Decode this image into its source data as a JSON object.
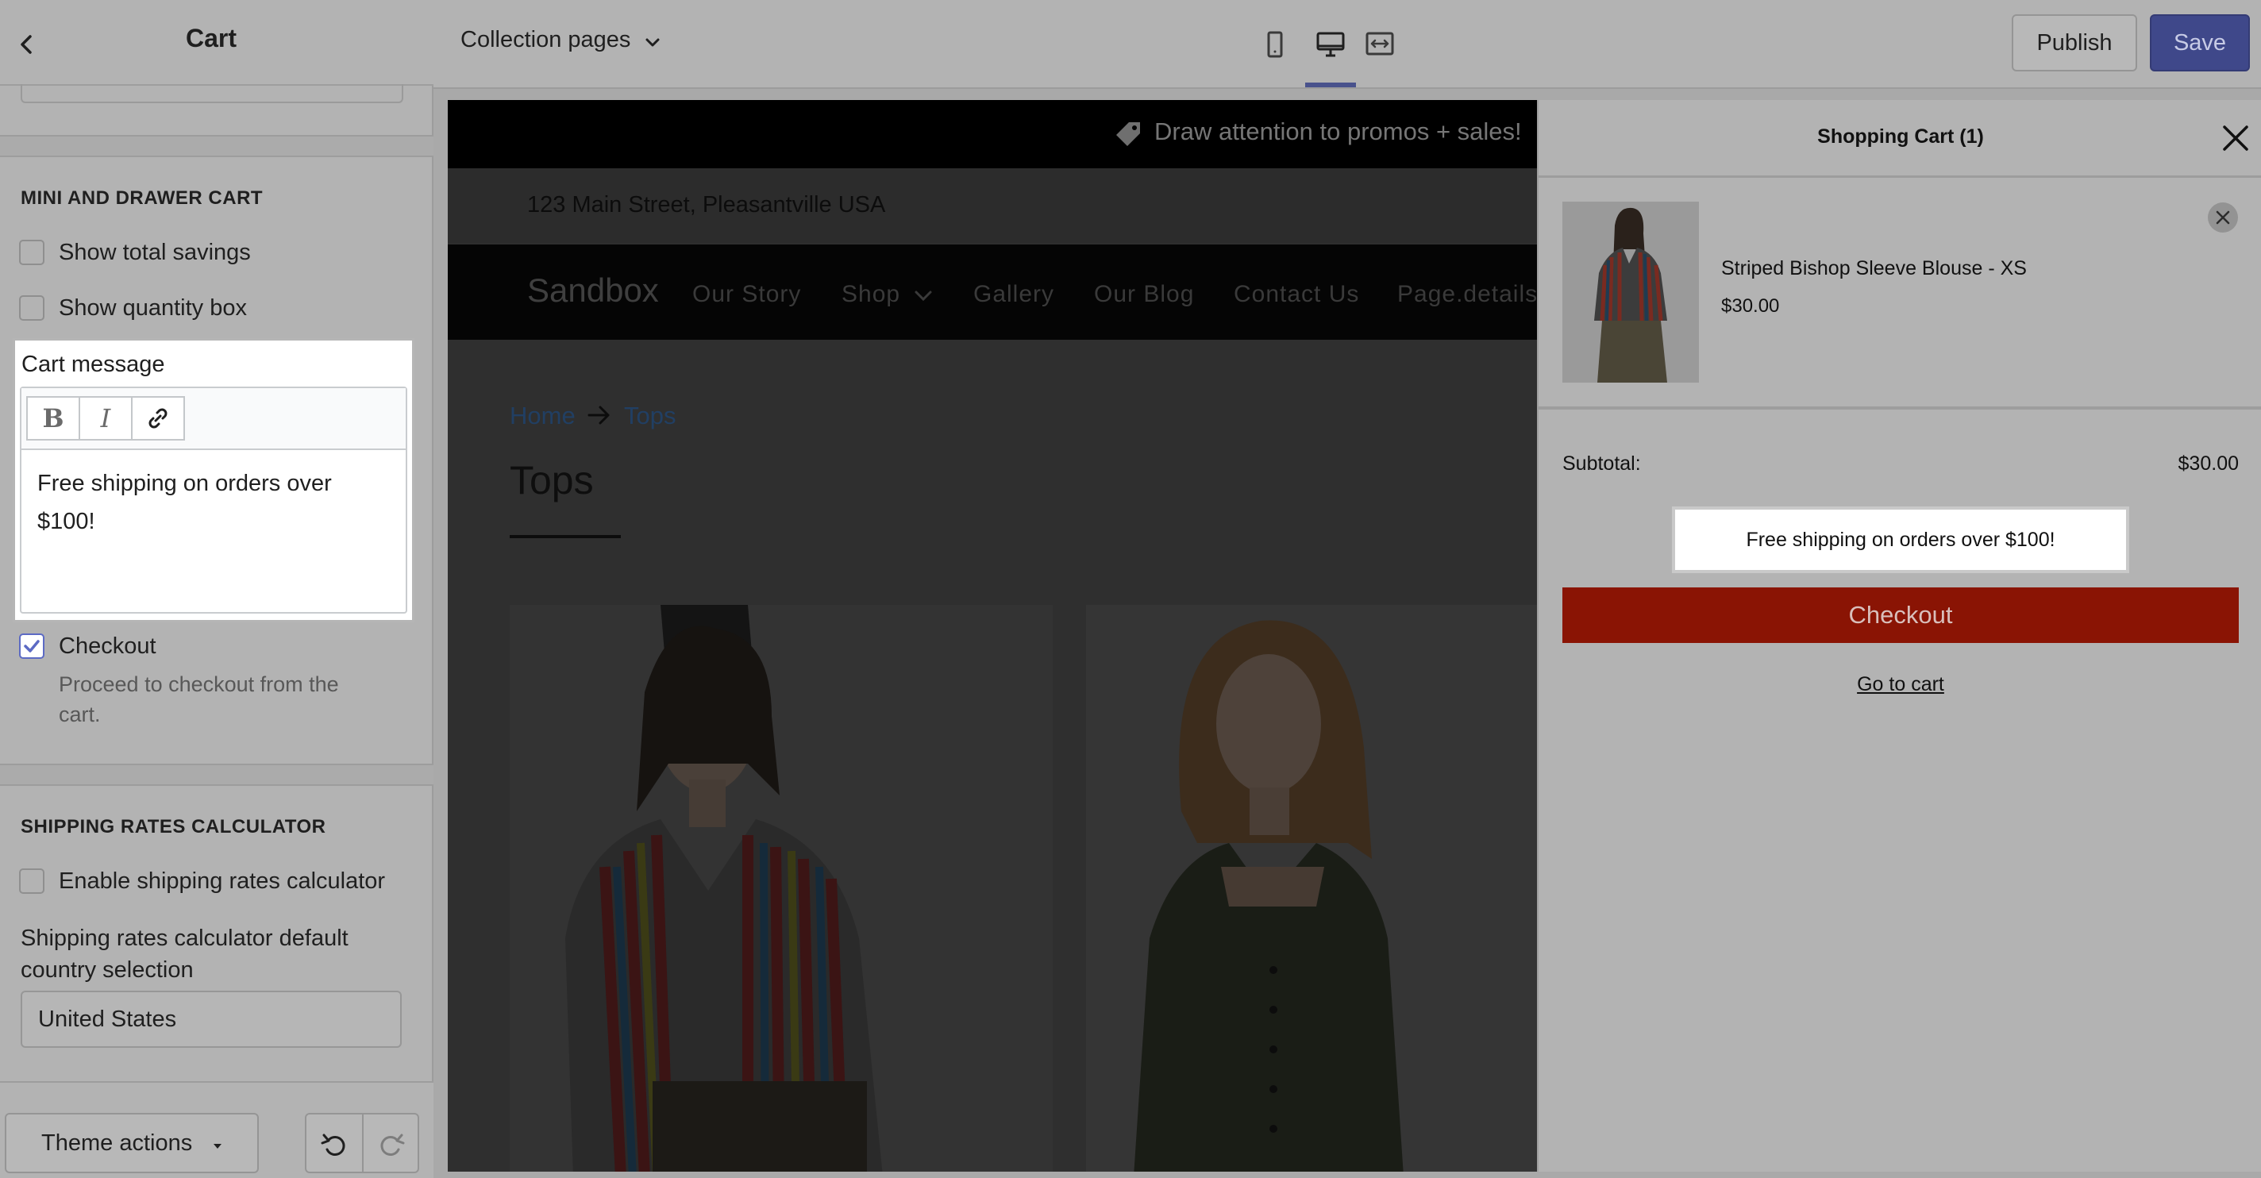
{
  "sidebar": {
    "title": "Cart",
    "mini_cart": {
      "heading": "MINI AND DRAWER CART",
      "show_total_savings": {
        "label": "Show total savings",
        "checked": false
      },
      "show_quantity_box": {
        "label": "Show quantity box",
        "checked": false
      }
    },
    "cart_message": {
      "label": "Cart message",
      "toolbar": {
        "bold": "B",
        "italic": "I"
      },
      "value_line1": "Free shipping on orders over",
      "value_line2": "$100!"
    },
    "checkout": {
      "label": "Checkout",
      "checked": true,
      "help_line1": "Proceed to checkout from the",
      "help_line2": "cart."
    },
    "shipping": {
      "heading": "SHIPPING RATES CALCULATOR",
      "enable": {
        "label": "Enable shipping rates calculator",
        "checked": false
      },
      "country_label_line1": "Shipping rates calculator default",
      "country_label_line2": "country selection",
      "country_value": "United States"
    },
    "footer": {
      "theme_actions": "Theme actions"
    }
  },
  "topbar": {
    "page_select": "Collection pages",
    "publish": "Publish",
    "save": "Save",
    "active_device": "desktop"
  },
  "preview": {
    "promo": "Draw attention to promos + sales!",
    "address": "123 Main Street, Pleasantville USA",
    "brand": "Sandbox",
    "nav": [
      "Our Story",
      "Shop",
      "Gallery",
      "Our Blog",
      "Contact Us",
      "Page.details"
    ],
    "breadcrumb": {
      "home": "Home",
      "current": "Tops"
    },
    "collection_title": "Tops"
  },
  "drawer": {
    "title": "Shopping Cart (1)",
    "item": {
      "name": "Striped Bishop Sleeve Blouse - XS",
      "price": "$30.00"
    },
    "subtotal_label": "Subtotal:",
    "subtotal_value": "$30.00",
    "note": "Free shipping on orders over $100!",
    "checkout": "Checkout",
    "go_to_cart": "Go to cart"
  },
  "colors": {
    "accent": "#5c6ac4",
    "save_button": "#3f488a",
    "checkout_button": "#8a1404",
    "overlay_sidebar": "#b3b3b3"
  }
}
